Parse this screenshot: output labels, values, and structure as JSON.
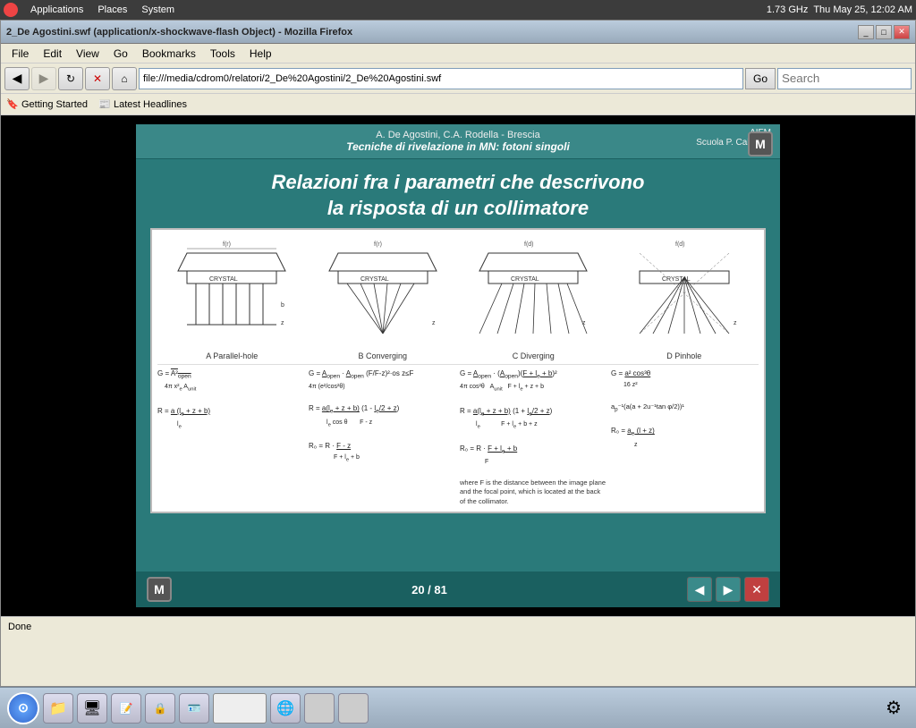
{
  "desktop": {
    "topbar": {
      "applications": "Applications",
      "places": "Places",
      "system": "System",
      "datetime": "Thu May 25, 12:02 AM",
      "cpu": "1.73 GHz"
    }
  },
  "firefox": {
    "title": "2_De Agostini.swf (application/x-shockwave-flash Object) - Mozilla Firefox",
    "menubar": [
      "File",
      "Edit",
      "View",
      "Go",
      "Bookmarks",
      "Tools",
      "Help"
    ],
    "address": "file:///media/cdrom0/relatori/2_De%20Agostini/2_De%20Agostini.swf",
    "go_btn": "Go",
    "bookmarks": [
      "Getting Started",
      "Latest Headlines"
    ],
    "statusbar": "Done"
  },
  "slide": {
    "author": "A. De Agostini, C.A. Rodella - Brescia",
    "subtitle": "Tecniche di rivelazione in MN: fotoni singoli",
    "organization": "AIFM",
    "school": "Scuola P. Caldirola",
    "title_line1": "Relazioni fra i parametri che descrivono",
    "title_line2": "la risposta di un collimatore",
    "m_label": "M",
    "page": "20 / 81",
    "sections": [
      {
        "label": "A  Parallel-hole",
        "key": "A"
      },
      {
        "label": "B  Converging",
        "key": "B"
      },
      {
        "label": "C  Diverging",
        "key": "C"
      },
      {
        "label": "D  Pinhole",
        "key": "D"
      }
    ],
    "note_text": "where F is the distance between the image plane and the focal point, which is located at the back of the collimator."
  },
  "taskbar": {
    "gear_icon": "⚙"
  }
}
